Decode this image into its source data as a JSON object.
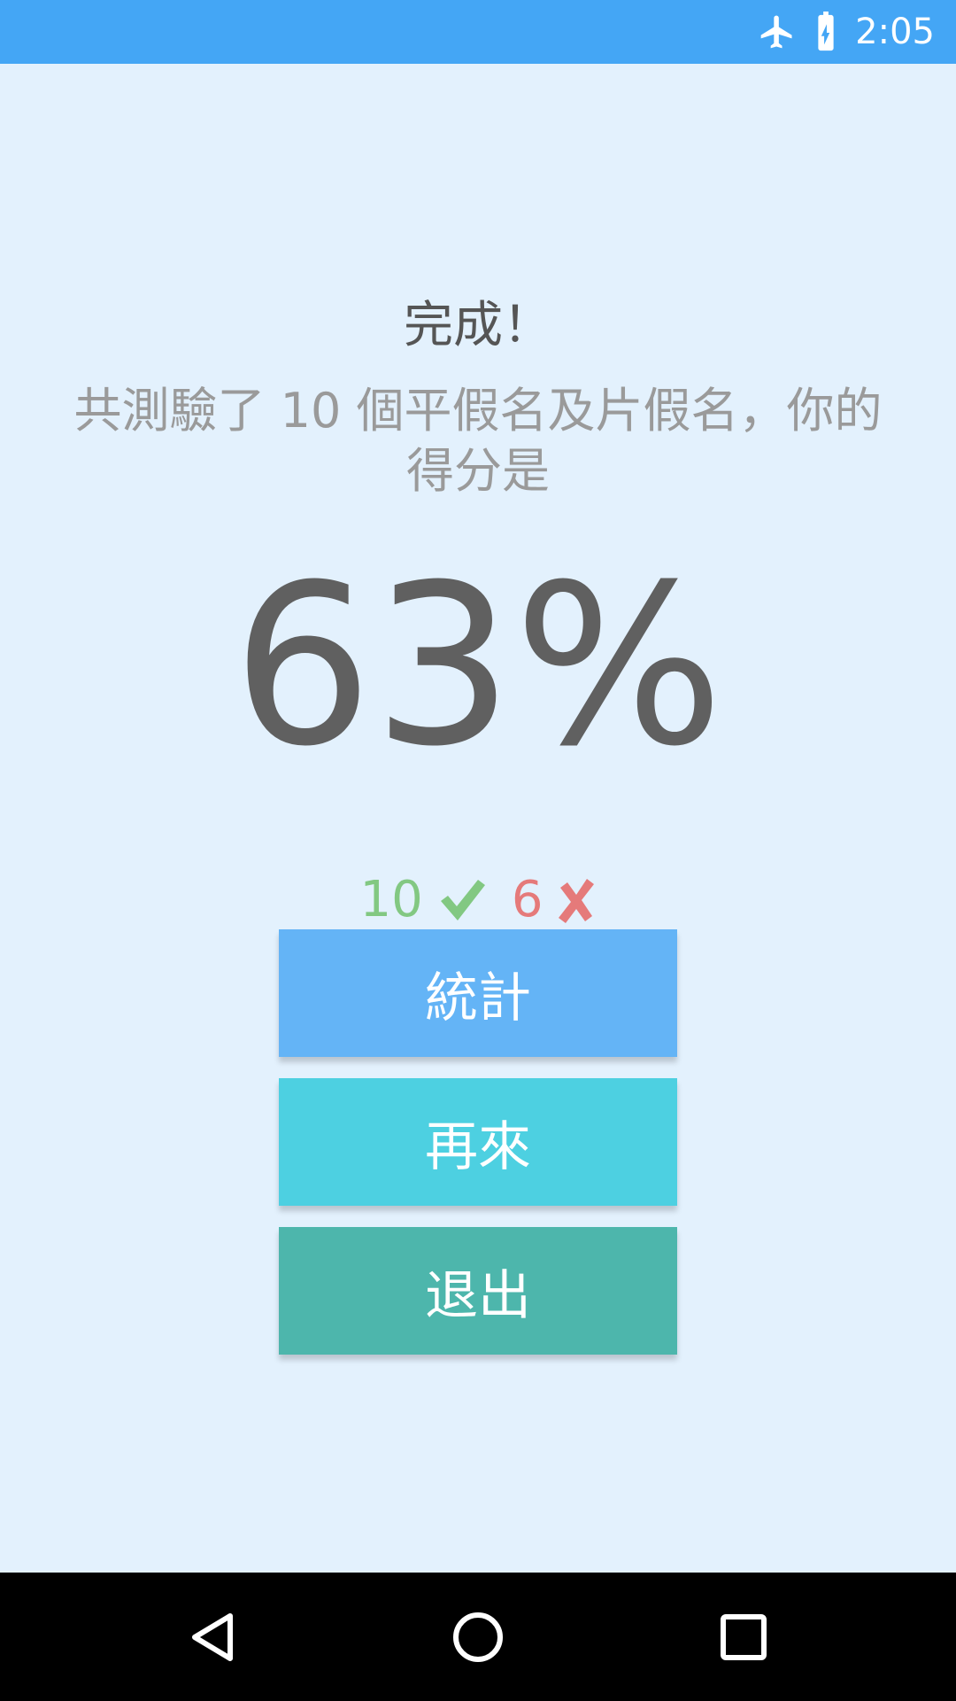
{
  "status_bar": {
    "time": "2:05",
    "icons": [
      "airplane-icon",
      "battery-charging-icon"
    ],
    "color": "#44a6f5"
  },
  "result": {
    "title": "完成！",
    "subtitle": "共測驗了 10 個平假名及片假名，你的得分是",
    "score": "63%",
    "correct_count": "10",
    "wrong_count": "6",
    "correct_color": "#82c882",
    "wrong_color": "#e57a7a"
  },
  "buttons": {
    "stats_label": "統計",
    "retry_label": "再來",
    "exit_label": "退出",
    "stats_color": "#64b4f6",
    "retry_color": "#4dd0e1",
    "exit_color": "#4db6ac"
  },
  "nav_bar": {
    "icons": [
      "back-icon",
      "home-icon",
      "recents-icon"
    ]
  }
}
